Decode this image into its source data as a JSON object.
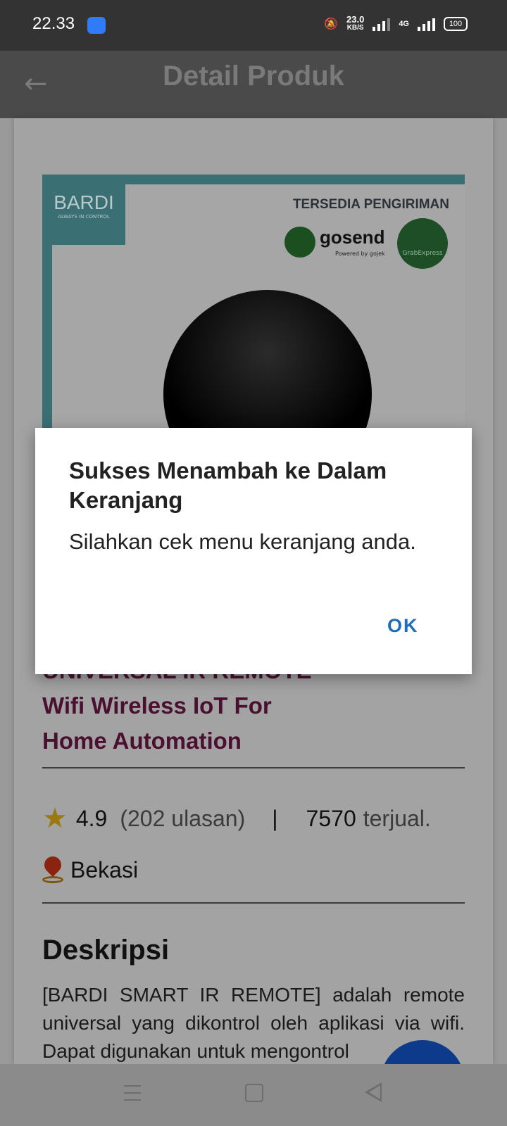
{
  "status_bar": {
    "time": "22.33",
    "speed_value": "23.0",
    "speed_unit": "KB/S",
    "network": "4G",
    "battery": "100"
  },
  "app_bar": {
    "title": "Detail Produk"
  },
  "product_image": {
    "brand": "BARDI",
    "brand_tagline": "ALWAYS IN CONTROL",
    "shipping_label": "TERSEDIA PENGIRIMAN",
    "gosend_label": "gosend",
    "gosend_powered": "Powered by gojek",
    "grab_label": "GrabExpress"
  },
  "product": {
    "name_line1": "UNIVERSAL IR REMOTE",
    "name_line2": "Wifi Wireless IoT For",
    "name_line3": "Home Automation",
    "rating": "4.9",
    "reviews": "(202 ulasan)",
    "separator": "|",
    "sold_count": "7570",
    "sold_label": "terjual.",
    "location": "Bekasi"
  },
  "description": {
    "heading": "Deskripsi",
    "text": "[BARDI SMART IR REMOTE] adalah remote universal yang dikontrol oleh aplikasi via wifi. Dapat digunakan untuk mengontrol"
  },
  "fab": {
    "label": "+"
  },
  "dialog": {
    "title": "Sukses Menambah ke Dalam Keranjang",
    "message": "Silahkan cek menu keranjang anda.",
    "ok_label": "OK"
  },
  "colors": {
    "accent": "#1e6fb8",
    "product_name": "#4a1030",
    "fab": "#0d3a8a"
  }
}
